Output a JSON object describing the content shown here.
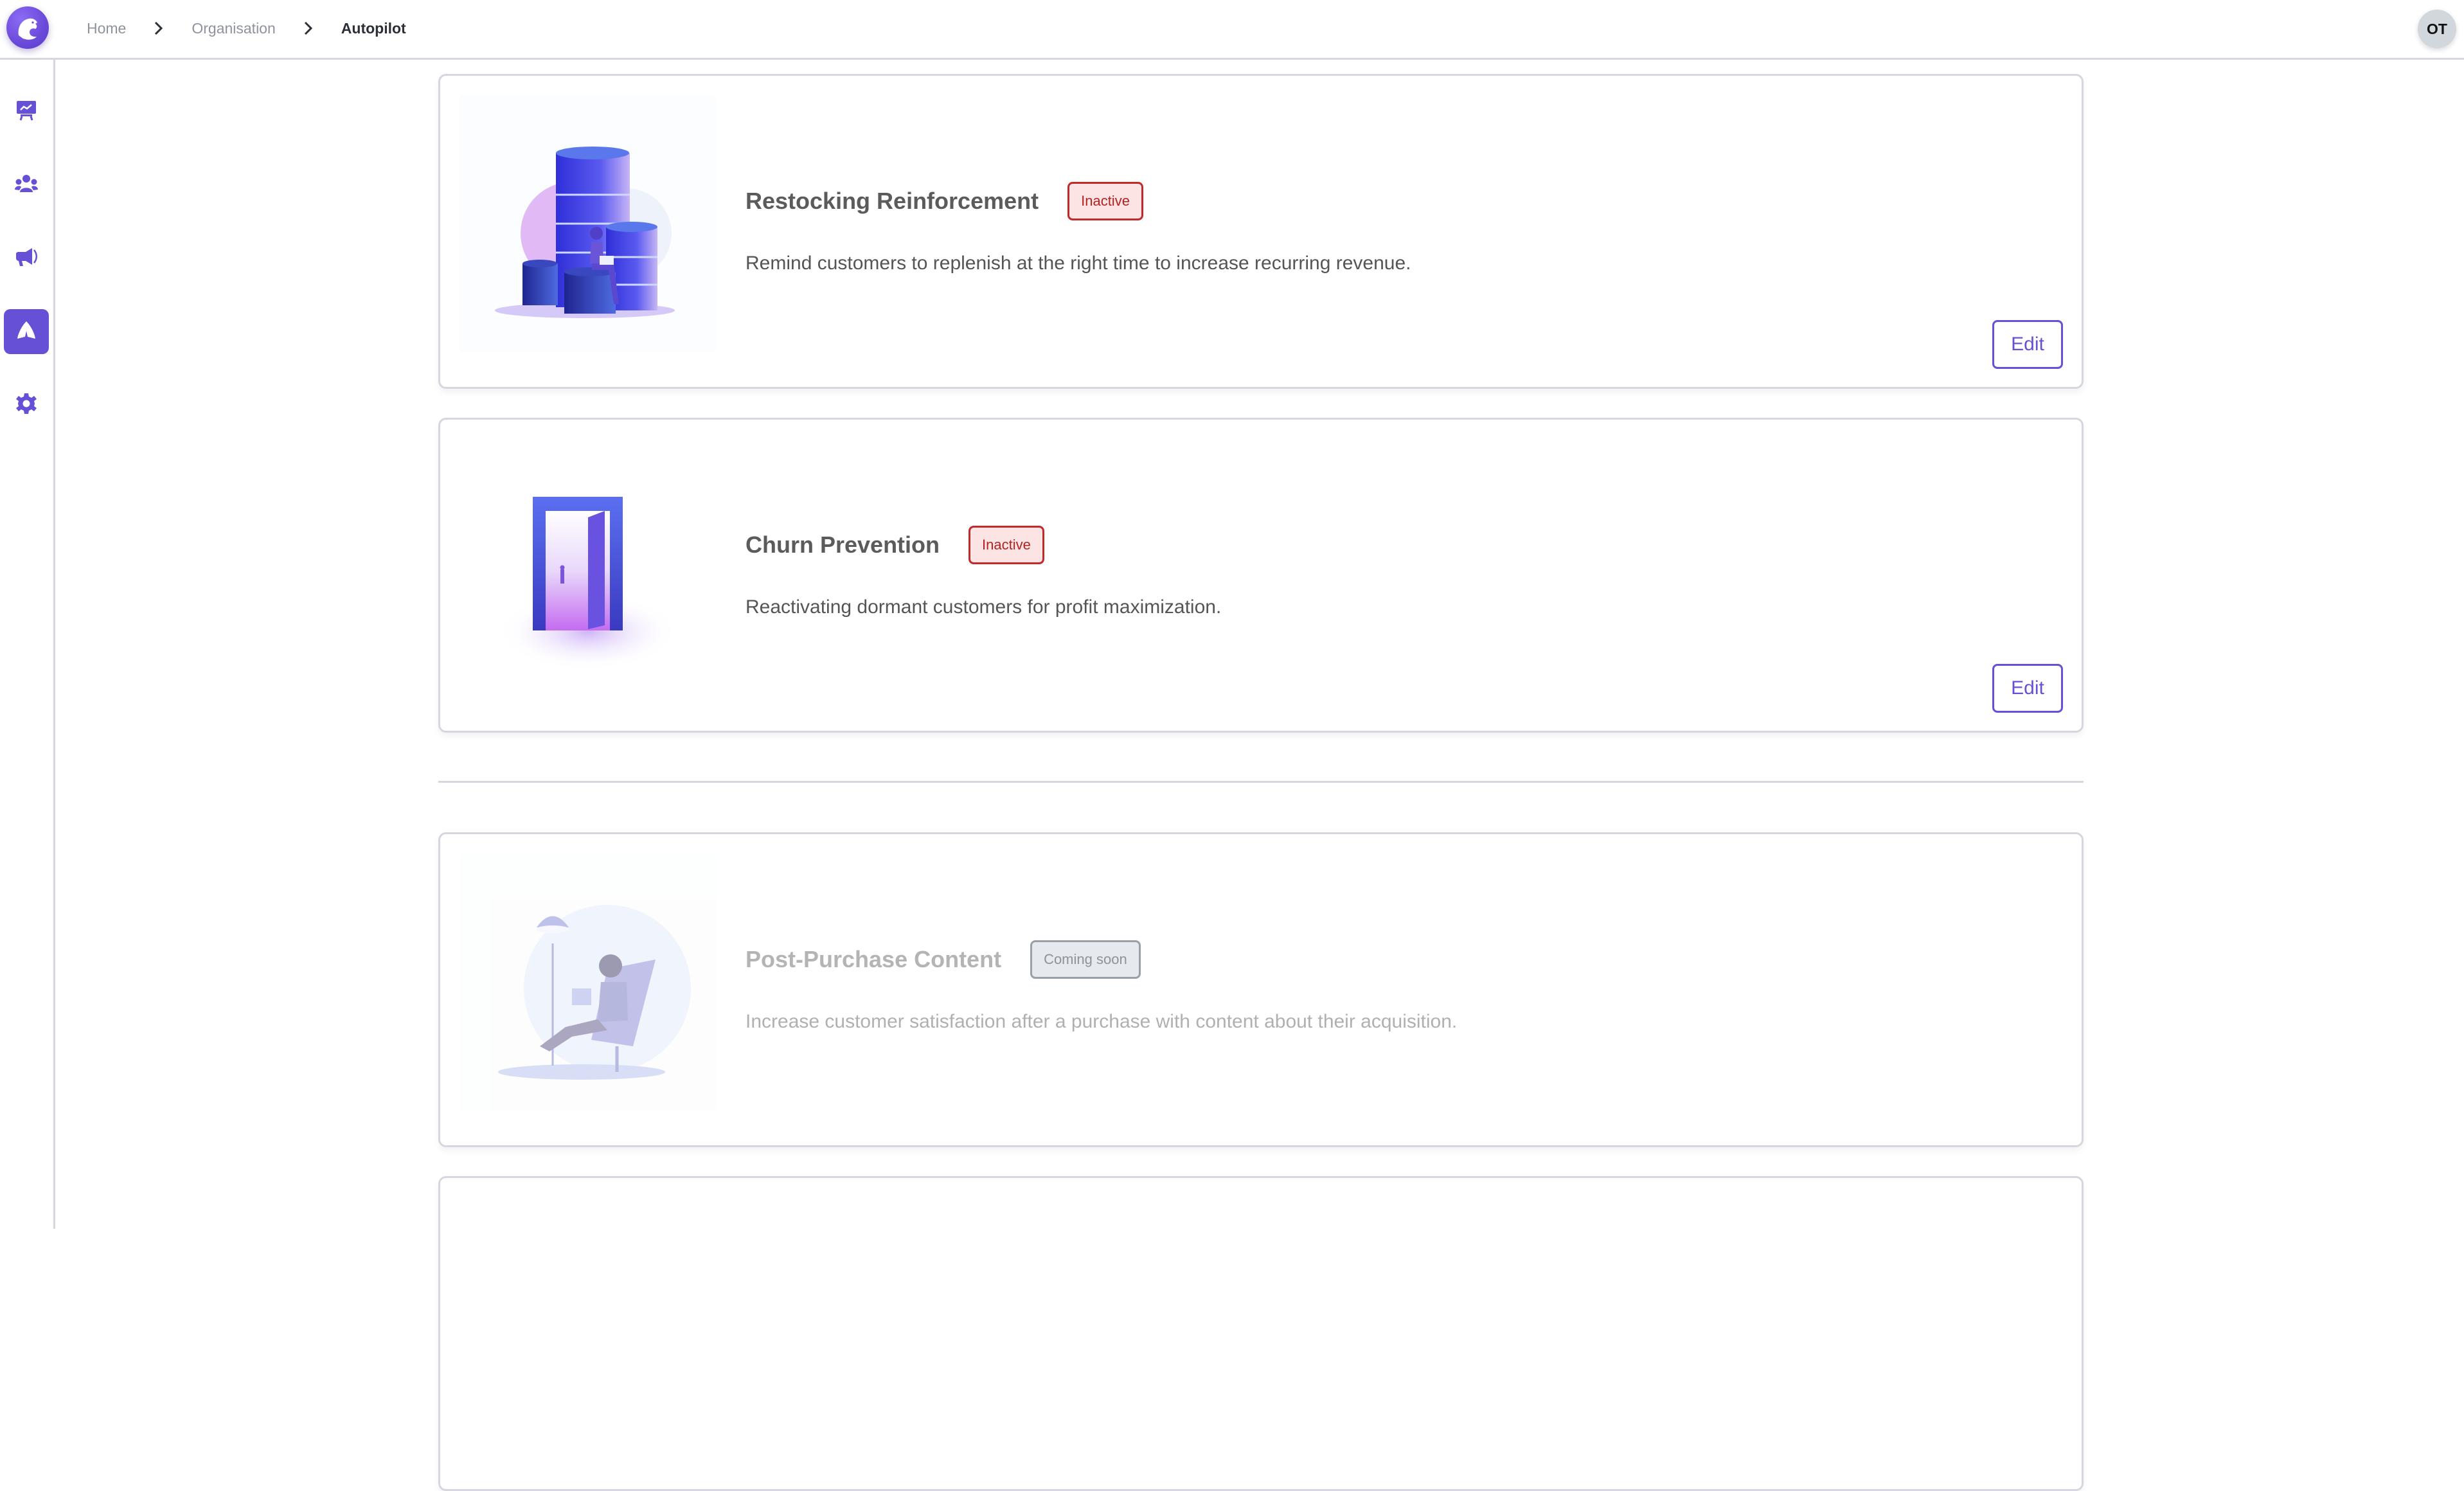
{
  "topbar": {
    "logo_icon": "eagle-logo-icon",
    "breadcrumb": [
      "Home",
      "Organisation",
      "Autopilot"
    ],
    "separator_icon": "chevron-right-icon",
    "avatar_initials": "OT"
  },
  "sidebar": {
    "items": [
      {
        "icon": "presentation-chart-icon",
        "active": false
      },
      {
        "icon": "users-group-icon",
        "active": false
      },
      {
        "icon": "megaphone-icon",
        "active": false
      },
      {
        "icon": "autopilot-icon",
        "active": true
      },
      {
        "icon": "gear-icon",
        "active": false
      }
    ],
    "accent_color": "#6550d6"
  },
  "cards": [
    {
      "title": "Restocking Reinforcement",
      "badge": "Inactive",
      "description": "Remind customers to replenish at the right time to increase recurring revenue.",
      "button": "Edit",
      "illustration": "databases-illustration"
    },
    {
      "title": "Churn Prevention",
      "badge": "Inactive",
      "description": "Reactivating dormant customers for profit maximization.",
      "button": "Edit",
      "illustration": "open-door-illustration"
    },
    {
      "title": "Post-Purchase Content",
      "badge": "Coming soon",
      "description": "Increase customer satisfaction after a purchase with content about their acquisition.",
      "illustration": "reading-chair-illustration"
    }
  ],
  "colors": {
    "accent": "#6550d6",
    "inactive_badge_text": "#b42222",
    "inactive_badge_bg": "#fde4e4",
    "coming_soon_bg": "#e6e9ed"
  }
}
